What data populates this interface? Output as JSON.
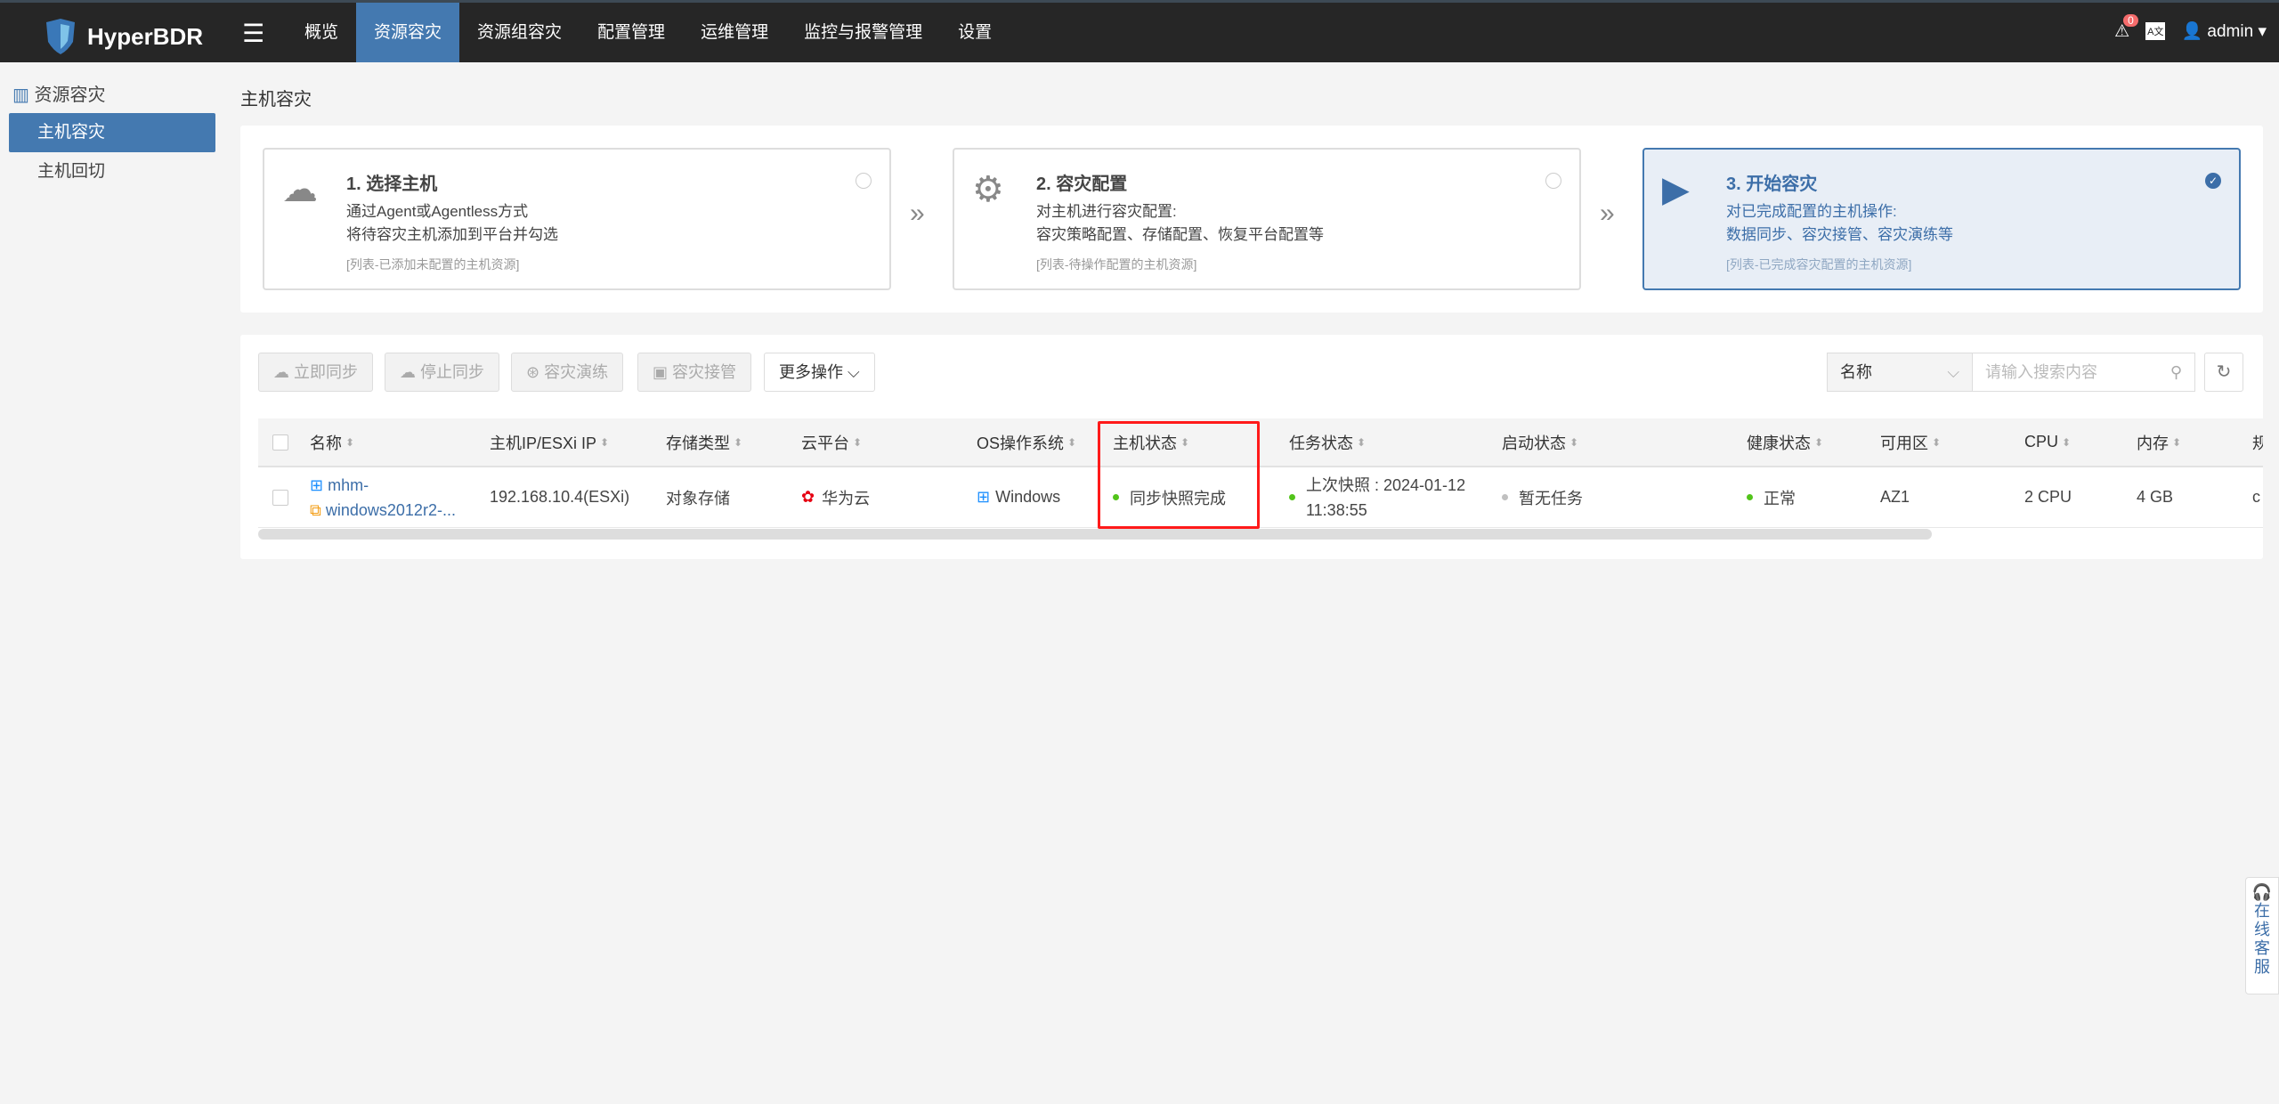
{
  "app": {
    "name": "HyperBDR"
  },
  "nav": {
    "items": [
      "概览",
      "资源容灾",
      "资源组容灾",
      "配置管理",
      "运维管理",
      "监控与报警管理",
      "设置"
    ],
    "active": 1
  },
  "header": {
    "alert_count": "0",
    "lang_icon": "A文",
    "user": "admin"
  },
  "sidebar": {
    "group": "资源容灾",
    "items": [
      "主机容灾",
      "主机回切"
    ]
  },
  "page": {
    "title": "主机容灾"
  },
  "steps": [
    {
      "title": "1. 选择主机",
      "line1": "通过Agent或Agentless方式",
      "line2": "将待容灾主机添加到平台并勾选",
      "note": "[列表-已添加未配置的主机资源]"
    },
    {
      "title": "2. 容灾配置",
      "line1": "对主机进行容灾配置:",
      "line2": "容灾策略配置、存储配置、恢复平台配置等",
      "note": "[列表-待操作配置的主机资源]"
    },
    {
      "title": "3. 开始容灾",
      "line1": "对已完成配置的主机操作:",
      "line2": "数据同步、容灾接管、容灾演练等",
      "note": "[列表-已完成容灾配置的主机资源]"
    }
  ],
  "toolbar": {
    "buttons": [
      "立即同步",
      "停止同步",
      "容灾演练",
      "容灾接管"
    ],
    "more": "更多操作",
    "search_field": "名称",
    "search_placeholder": "请输入搜索内容"
  },
  "table": {
    "columns": [
      "名称",
      "主机IP/ESXi IP",
      "存储类型",
      "云平台",
      "OS操作系统",
      "主机状态",
      "任务状态",
      "启动状态",
      "健康状态",
      "可用区",
      "CPU",
      "内存",
      "规"
    ],
    "rows": [
      {
        "name1": "mhm-",
        "name2": "windows2012r2-...",
        "ip": "192.168.10.4(ESXi)",
        "storage": "对象存储",
        "cloud": "华为云",
        "os": "Windows",
        "host_status": "同步快照完成",
        "task_status1": "上次快照 : 2024-01-12",
        "task_status2": "11:38:55",
        "boot_status": "暂无任务",
        "health": "正常",
        "az": "AZ1",
        "cpu": "2 CPU",
        "mem": "4 GB",
        "spec": "c"
      }
    ]
  },
  "colors": {
    "accent": "#4479b0",
    "ok": "#52c41a",
    "idle": "#c0c0c0",
    "highlight": "#ff1a1a"
  },
  "support": {
    "label": "在线客服"
  }
}
